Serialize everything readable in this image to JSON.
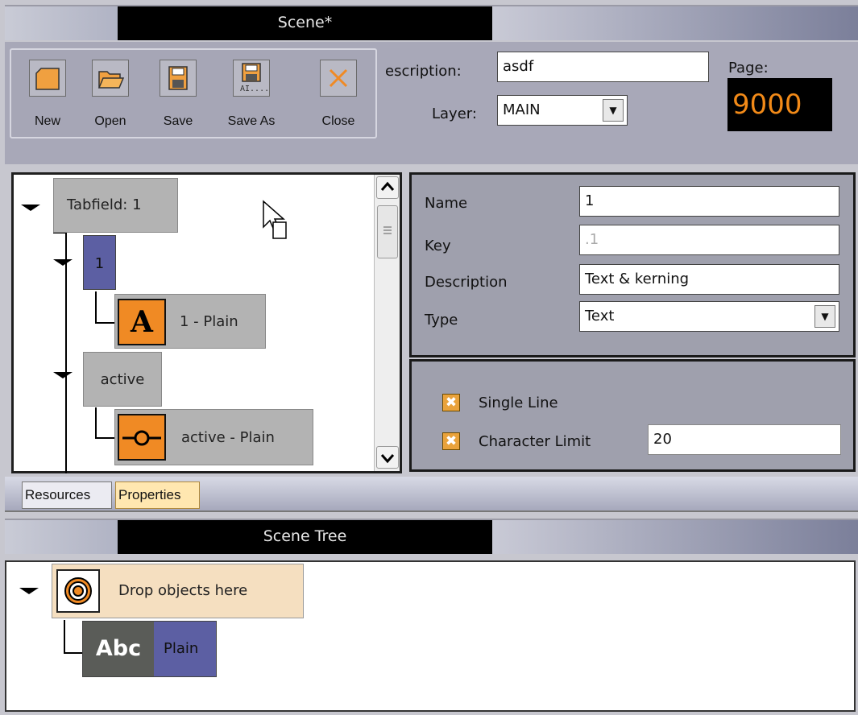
{
  "scene_window": {
    "title": "Scene*"
  },
  "toolbar": {
    "buttons": [
      {
        "label": "New",
        "icon": "new-file-icon"
      },
      {
        "label": "Open",
        "icon": "folder-open-icon"
      },
      {
        "label": "Save",
        "icon": "floppy-disk-icon"
      },
      {
        "label": "Save As",
        "icon": "floppy-save-as-icon"
      },
      {
        "label": "Close",
        "icon": "close-x-icon"
      }
    ]
  },
  "scene_header": {
    "description_label": "escription:",
    "description_value": "asdf",
    "layer_label": "Layer:",
    "layer_value": "MAIN",
    "page_label": "Page:",
    "page_value": "9000"
  },
  "tree": {
    "nodes": {
      "tabfield": "Tabfield: 1",
      "item_1": "1",
      "item_1_plain": "1 - Plain",
      "active": "active",
      "active_plain": "active - Plain"
    },
    "icon_letter": "A"
  },
  "properties": {
    "name_label": "Name",
    "name_value": "1",
    "key_label": "Key",
    "key_value": ".1",
    "description_label": "Description",
    "description_value": "Text & kerning",
    "type_label": "Type",
    "type_value": "Text",
    "single_line_label": "Single Line",
    "char_limit_label": "Character Limit",
    "char_limit_value": "20"
  },
  "tabs": {
    "resources": "Resources",
    "properties": "Properties"
  },
  "scene_tree": {
    "title": "Scene Tree",
    "drop_label": "Drop objects here",
    "abc_icon_text": "Abc",
    "plain_label": "Plain"
  },
  "colors": {
    "accent_orange": "#f08a24",
    "node_purple": "#5c5fa3",
    "page_digits": "#f28a18"
  }
}
